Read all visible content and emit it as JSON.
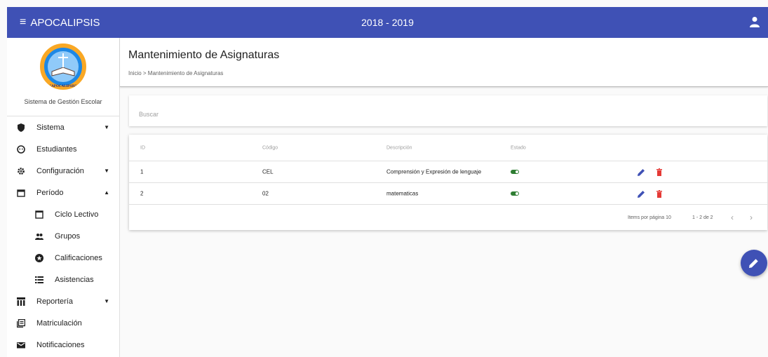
{
  "app": {
    "title": "APOCALIPSIS",
    "year": "2018 - 2019"
  },
  "sidebar": {
    "logo_text": "\"APOCALIPSIS\"",
    "subtitle": "Sistema de Gestión Escolar",
    "items": [
      {
        "label": "Sistema",
        "icon": "shield-icon",
        "caret": "down"
      },
      {
        "label": "Estudiantes",
        "icon": "face-icon"
      },
      {
        "label": "Configuración",
        "icon": "gear-icon",
        "caret": "down"
      },
      {
        "label": "Período",
        "icon": "calendar-icon",
        "caret": "up"
      },
      {
        "label": "Ciclo Lectivo",
        "icon": "square-icon",
        "child": true
      },
      {
        "label": "Grupos",
        "icon": "people-icon",
        "child": true
      },
      {
        "label": "Calificaciones",
        "icon": "star-circle-icon",
        "child": true
      },
      {
        "label": "Asistencias",
        "icon": "list-icon",
        "child": true
      },
      {
        "label": "Reportería",
        "icon": "table-icon",
        "caret": "down"
      },
      {
        "label": "Matriculación",
        "icon": "book-icon"
      },
      {
        "label": "Notificaciones",
        "icon": "mail-icon"
      }
    ]
  },
  "page": {
    "title": "Mantenimiento de Asignaturas",
    "breadcrumb": "Inicio > Mantenimiento de Asignaturas"
  },
  "search": {
    "placeholder": "Buscar"
  },
  "table": {
    "headers": {
      "id": "ID",
      "codigo": "Código",
      "descripcion": "Descripción",
      "estado": "Estado"
    },
    "rows": [
      {
        "id": "1",
        "codigo": "CEL",
        "descripcion": "Comprensión y Expresión de lenguaje"
      },
      {
        "id": "2",
        "codigo": "02",
        "descripcion": "matematicas"
      }
    ]
  },
  "pager": {
    "items_per_page": "Items por página 10",
    "range": "1 - 2 de 2",
    "prev": "‹",
    "next": "›"
  },
  "colors": {
    "primary": "#3f51b5",
    "active_toggle": "#2e7d32",
    "delete": "#e53935"
  }
}
